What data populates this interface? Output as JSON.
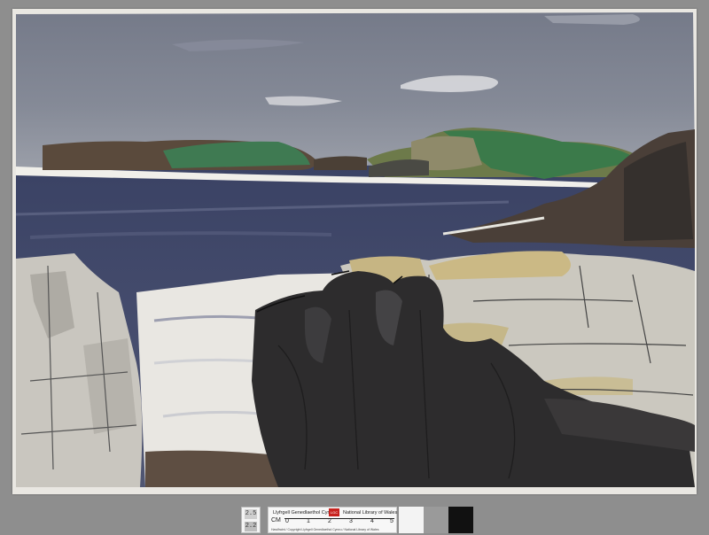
{
  "artwork": {
    "description_hidden": "",
    "palette": {
      "sky": "#7e8391",
      "sea": "#3e4566",
      "island_green": "#3f7a52",
      "rock_dark": "#2c2b2c",
      "rock_light": "#c9c6bd",
      "ochre": "#c8b784",
      "paper": "#e9e7e2"
    }
  },
  "reference_bar": {
    "patch_top": "2.5",
    "patch_bottom": "2.2",
    "library_welsh": "Llyfrgell Genedlaethol Cymru",
    "library_english": "National Library of Wales",
    "ruler_unit": "CM",
    "ruler_ticks": [
      "0",
      "1",
      "2",
      "3",
      "4",
      "5"
    ],
    "copyright": "Hawlfraint / Copyright Llyfrgell Genedlaethol Cymru / National Library of Wales"
  }
}
